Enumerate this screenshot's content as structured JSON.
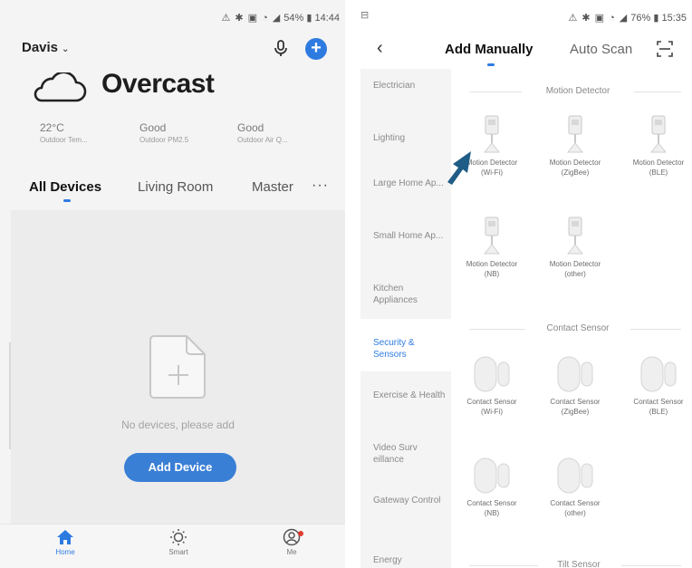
{
  "left": {
    "status": {
      "text": "54% ▮ 14:44"
    },
    "home_name": "Davis",
    "weather": {
      "condition": "Overcast",
      "metrics": [
        {
          "value": "22°C",
          "label": "Outdoor Tem..."
        },
        {
          "value": "Good",
          "label": "Outdoor PM2.5"
        },
        {
          "value": "Good",
          "label": "Outdoor Air Q..."
        }
      ]
    },
    "tabs": [
      "All Devices",
      "Living Room",
      "Master",
      "···"
    ],
    "empty_text": "No devices, please add",
    "add_device_label": "Add Device",
    "nav": [
      "Home",
      "Smart",
      "Me"
    ]
  },
  "right": {
    "status": {
      "left": "⊟",
      "text": "76% ▮ 15:35"
    },
    "tabs": [
      "Add Manually",
      "Auto Scan"
    ],
    "categories": [
      "Electrician",
      "Lighting",
      "Large Home Ap...",
      "Small Home Ap...",
      "Kitchen Appliances",
      "Security & Sensors",
      "Exercise & Health",
      "Video Surv eillance",
      "Gateway Control",
      "Energy"
    ],
    "sections": [
      {
        "title": "Motion Detector",
        "devices": [
          "Motion Detector (Wi-Fi)",
          "Motion Detector (ZigBee)",
          "Motion Detector (BLE)",
          "Motion Detector (NB)",
          "Motion Detector (other)"
        ]
      },
      {
        "title": "Contact Sensor",
        "devices": [
          "Contact Sensor (Wi-Fi)",
          "Contact Sensor (ZigBee)",
          "Contact Sensor (BLE)",
          "Contact Sensor (NB)",
          "Contact Sensor (other)"
        ]
      },
      {
        "title": "Tilt Sensor"
      }
    ]
  },
  "colors": {
    "accent": "#2e7be0",
    "arrow": "#1f5d86"
  }
}
